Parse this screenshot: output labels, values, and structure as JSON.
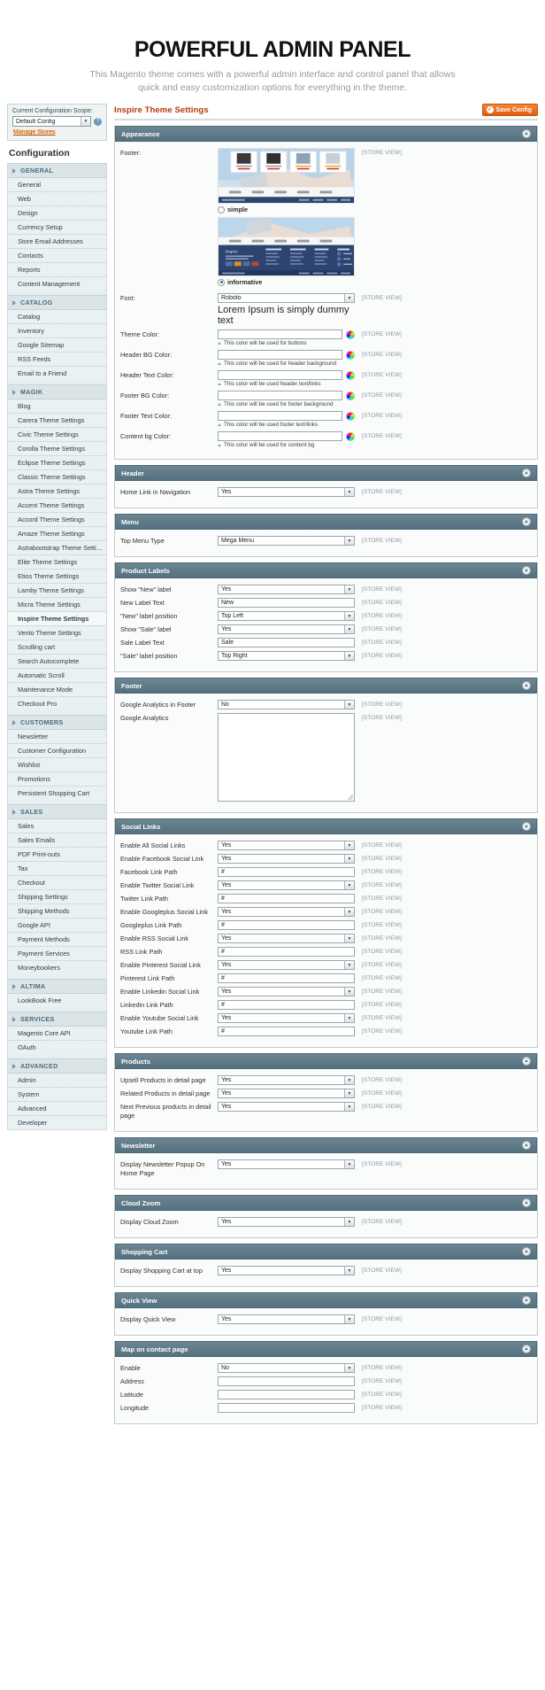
{
  "hero": {
    "title": "POWERFUL ADMIN PANEL",
    "subtitle": "This Magento theme comes with a powerful admin interface and control panel that allows quick and easy customization options for everything in the theme."
  },
  "scope": {
    "label": "Current Configuration Scope:",
    "value": "Default Config",
    "manage_link": "Manage Stores",
    "help_icon": "help-icon"
  },
  "sidebar": {
    "title": "Configuration",
    "groups": [
      {
        "label": "GENERAL",
        "items": [
          "General",
          "Web",
          "Design",
          "Currency Setup",
          "Store Email Addresses",
          "Contacts",
          "Reports",
          "Content Management"
        ]
      },
      {
        "label": "CATALOG",
        "items": [
          "Catalog",
          "Inventory",
          "Google Sitemap",
          "RSS Feeds",
          "Email to a Friend"
        ]
      },
      {
        "label": "MAGIK",
        "items": [
          "Blog",
          "Carera Theme Settings",
          "Civic Theme Settings",
          "Corolla Theme Settings",
          "Eclipse Theme Settings",
          "Classic Theme Settings",
          "Astra Theme Settings",
          "Accent Theme Settings",
          "Accord Theme Settings",
          "Amaze Theme Settings",
          "Astrabootstrap Theme Settings",
          "Elite Theme Settings",
          "Etios Theme Settings",
          "Lamby Theme Settings",
          "Micra Theme Settings",
          "Inspire Theme Settings",
          "Vento Theme Settings",
          "Scrolling cart",
          "Search Autocomplete",
          "Automatic Scroll",
          "Maintenance Mode",
          "Checkout Pro"
        ],
        "active": "Inspire Theme Settings"
      },
      {
        "label": "CUSTOMERS",
        "items": [
          "Newsletter",
          "Customer Configuration",
          "Wishlist",
          "Promotions",
          "Persistent Shopping Cart"
        ]
      },
      {
        "label": "SALES",
        "items": [
          "Sales",
          "Sales Emails",
          "PDF Print-outs",
          "Tax",
          "Checkout",
          "Shipping Settings",
          "Shipping Methods",
          "Google API",
          "Payment Methods",
          "Payment Services",
          "Moneybookers"
        ]
      },
      {
        "label": "ALTIMA",
        "items": [
          "LookBook Free"
        ]
      },
      {
        "label": "SERVICES",
        "items": [
          "Magento Core API",
          "OAuth"
        ]
      },
      {
        "label": "ADVANCED",
        "items": [
          "Admin",
          "System",
          "Advanced",
          "Developer"
        ]
      }
    ]
  },
  "page": {
    "title": "Inspire Theme Settings",
    "save_label": "Save Config",
    "scope_tag": "[STORE VIEW]"
  },
  "sections": {
    "appearance": {
      "title": "Appearance",
      "footer_label": "Footer:",
      "option_simple": "simple",
      "option_informative": "informative",
      "selected_option": "informative",
      "font_label": "Font:",
      "font_value": "Roboto",
      "font_sample": "Lorem Ipsum is simply dummy text",
      "colors": [
        {
          "label": "Theme Color:",
          "value": "",
          "hint": "This color will be used for buttons"
        },
        {
          "label": "Header BG Color:",
          "value": "",
          "hint": "This color will be used for header background"
        },
        {
          "label": "Header Text Color:",
          "value": "",
          "hint": "This color will be used header text/links"
        },
        {
          "label": "Footer BG Color:",
          "value": "",
          "hint": "This color will be used for footer background"
        },
        {
          "label": "Footer Text Color:",
          "value": "",
          "hint": "This color will be used footer text/links"
        },
        {
          "label": "Content bg Color:",
          "value": "",
          "hint": "This color will be used for content bg"
        }
      ]
    },
    "header": {
      "title": "Header",
      "rows": [
        {
          "label": "Home Link in Navigation",
          "type": "select",
          "value": "Yes"
        }
      ]
    },
    "menu": {
      "title": "Menu",
      "rows": [
        {
          "label": "Top Menu Type",
          "type": "select",
          "value": "Mega Menu"
        }
      ]
    },
    "product_labels": {
      "title": "Product Labels",
      "rows": [
        {
          "label": "Show \"New\" label",
          "type": "select",
          "value": "Yes"
        },
        {
          "label": "New Label Text",
          "type": "text",
          "value": "New"
        },
        {
          "label": "\"New\" label position",
          "type": "select",
          "value": "Top Left"
        },
        {
          "label": "Show \"Sale\" label",
          "type": "select",
          "value": "Yes"
        },
        {
          "label": "Sale Label Text",
          "type": "text",
          "value": "Sale"
        },
        {
          "label": "\"Sale\" label position",
          "type": "select",
          "value": "Top Right"
        }
      ]
    },
    "footer": {
      "title": "Footer",
      "rows": [
        {
          "label": "Google Analytics in Footer",
          "type": "select",
          "value": "No"
        },
        {
          "label": "Google Analytics",
          "type": "textarea",
          "value": ""
        }
      ]
    },
    "social_links": {
      "title": "Social Links",
      "rows": [
        {
          "label": "Enable All Social Links",
          "type": "select",
          "value": "Yes"
        },
        {
          "label": "Enable Facebook Social Link",
          "type": "select",
          "value": "Yes"
        },
        {
          "label": "Facebook Link Path",
          "type": "text",
          "value": "#"
        },
        {
          "label": "Enable Twitter Social Link",
          "type": "select",
          "value": "Yes"
        },
        {
          "label": "Twitter Link Path",
          "type": "text",
          "value": "#"
        },
        {
          "label": "Enable Googleplus Social Link",
          "type": "select",
          "value": "Yes"
        },
        {
          "label": "Googleplus Link Path",
          "type": "text",
          "value": "#"
        },
        {
          "label": "Enable RSS Social Link",
          "type": "select",
          "value": "Yes"
        },
        {
          "label": "RSS Link Path",
          "type": "text",
          "value": "#"
        },
        {
          "label": "Enable Pinterest Social Link",
          "type": "select",
          "value": "Yes"
        },
        {
          "label": "Pinterest Link Path",
          "type": "text",
          "value": "#"
        },
        {
          "label": "Enable Linkedin Social Link",
          "type": "select",
          "value": "Yes"
        },
        {
          "label": "Linkedin Link Path",
          "type": "text",
          "value": "#"
        },
        {
          "label": "Enable Youtube Social Link",
          "type": "select",
          "value": "Yes"
        },
        {
          "label": "Youtube Link Path",
          "type": "text",
          "value": "#"
        }
      ]
    },
    "products": {
      "title": "Products",
      "rows": [
        {
          "label": "Upsell Products in detail page",
          "type": "select",
          "value": "Yes"
        },
        {
          "label": "Related Products in detail page",
          "type": "select",
          "value": "Yes"
        },
        {
          "label": "Next Previous products in detail page",
          "type": "select",
          "value": "Yes"
        }
      ]
    },
    "newsletter": {
      "title": "Newsletter",
      "rows": [
        {
          "label": "Display Newsletter Popup On Home Page",
          "type": "select",
          "value": "Yes"
        }
      ]
    },
    "cloud_zoom": {
      "title": "Cloud Zoom",
      "rows": [
        {
          "label": "Display Cloud Zoom",
          "type": "select",
          "value": "Yes"
        }
      ]
    },
    "shopping_cart": {
      "title": "Shopping Cart",
      "rows": [
        {
          "label": "Display Shopping Cart at top",
          "type": "select",
          "value": "Yes"
        }
      ]
    },
    "quick_view": {
      "title": "Quick View",
      "rows": [
        {
          "label": "Display Quick View",
          "type": "select",
          "value": "Yes"
        }
      ]
    },
    "map_contact": {
      "title": "Map on contact page",
      "rows": [
        {
          "label": "Enable",
          "type": "select",
          "value": "No"
        },
        {
          "label": "Address",
          "type": "text",
          "value": ""
        },
        {
          "label": "Latitude",
          "type": "text",
          "value": ""
        },
        {
          "label": "Longitude",
          "type": "text",
          "value": ""
        }
      ]
    }
  }
}
